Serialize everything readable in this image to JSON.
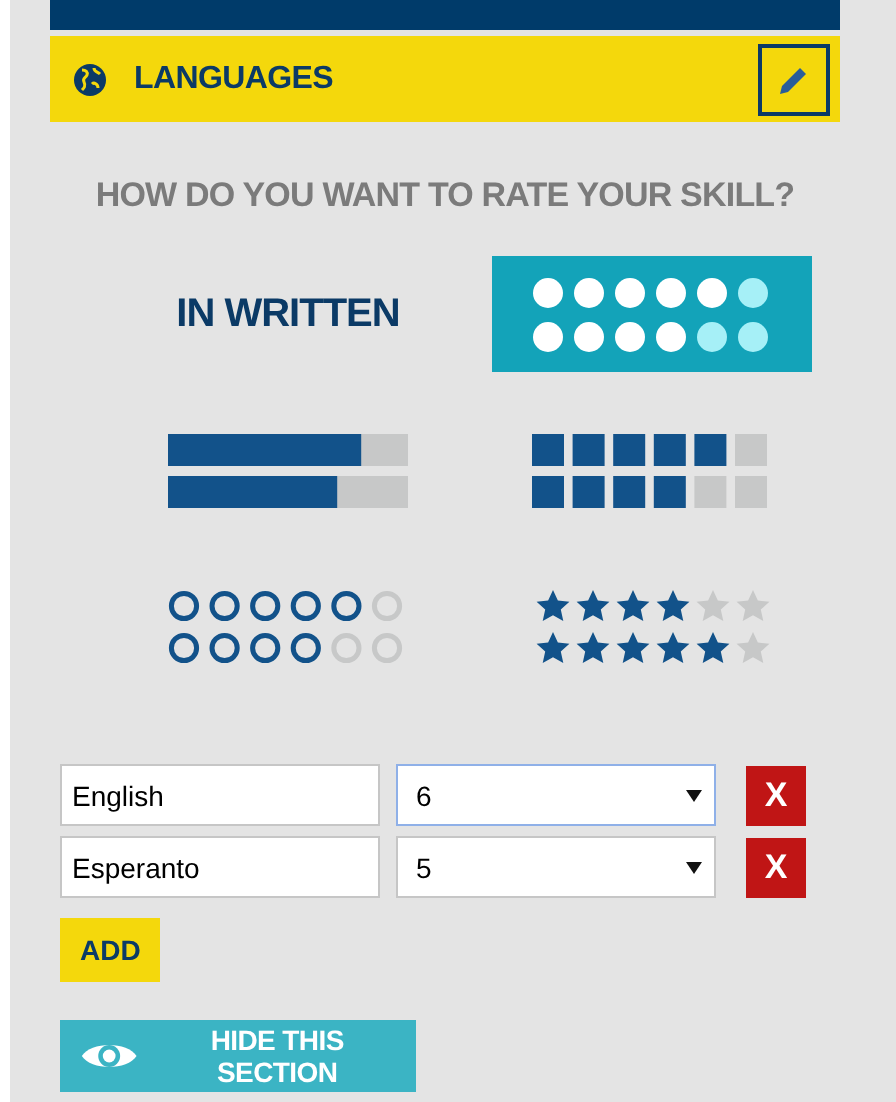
{
  "section": {
    "title": "LANGUAGES"
  },
  "rating": {
    "question": "HOW DO YOU WANT TO RATE YOUR SKILL?",
    "label": "IN WRITTEN",
    "styles": [
      {
        "kind": "dots",
        "selected": true,
        "rows": [
          {
            "level": 0.8333
          },
          {
            "level": 0.6667
          }
        ]
      },
      {
        "kind": "bars",
        "selected": false,
        "rows": [
          {
            "level": 0.83
          },
          {
            "level": 0.73
          }
        ]
      },
      {
        "kind": "squares",
        "selected": false,
        "rows": [
          {
            "level": 0.8333
          },
          {
            "level": 0.6667
          }
        ]
      },
      {
        "kind": "circles",
        "selected": false,
        "rows": [
          {
            "level": 0.8333
          },
          {
            "level": 0.6667
          }
        ]
      },
      {
        "kind": "stars",
        "selected": false,
        "rows": [
          {
            "stars": 4
          },
          {
            "stars": 5
          }
        ]
      }
    ]
  },
  "languages": [
    {
      "name": "English",
      "skill": "6",
      "focused": true,
      "remove": "X"
    },
    {
      "name": "Esperanto",
      "skill": "5",
      "focused": false,
      "remove": "X"
    }
  ],
  "add_button": "ADD",
  "hide_button": "HIDE THIS SECTION"
}
